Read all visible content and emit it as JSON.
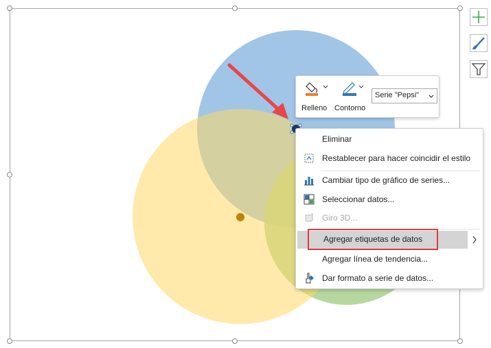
{
  "colors": {
    "blue_circle": "#9dc3e6",
    "yellow_circle": "#ffd966",
    "green_circle": "#a9d18e",
    "arrow": "#e8454b",
    "highlight_border": "#e0393f",
    "plus_icon": "#3fa35a"
  },
  "side_buttons": [
    "plus-icon",
    "brush-icon",
    "filter-icon"
  ],
  "mini_toolbar": {
    "fill_label": "Relleno",
    "outline_label": "Contorno",
    "series_select": "Serie \"Pepsi\""
  },
  "context_menu": {
    "items": [
      {
        "label": "Eliminar",
        "icon": "none",
        "enabled": true
      },
      {
        "label": "Restablecer para hacer coincidir el estilo",
        "icon": "reset-style-icon",
        "enabled": true
      },
      {
        "label": "Cambiar tipo de gráfico de series...",
        "icon": "bar-chart-icon",
        "enabled": true
      },
      {
        "label": "Seleccionar datos...",
        "icon": "select-data-icon",
        "enabled": true
      },
      {
        "label": "Giro 3D...",
        "icon": "rotate-3d-icon",
        "enabled": false
      },
      {
        "label": "Agregar etiquetas de datos",
        "icon": "none",
        "enabled": true,
        "submenu": true
      },
      {
        "label": "Agregar línea de tendencia...",
        "icon": "none",
        "enabled": true
      },
      {
        "label": "Dar formato a serie de datos...",
        "icon": "format-series-icon",
        "enabled": true
      }
    ]
  }
}
